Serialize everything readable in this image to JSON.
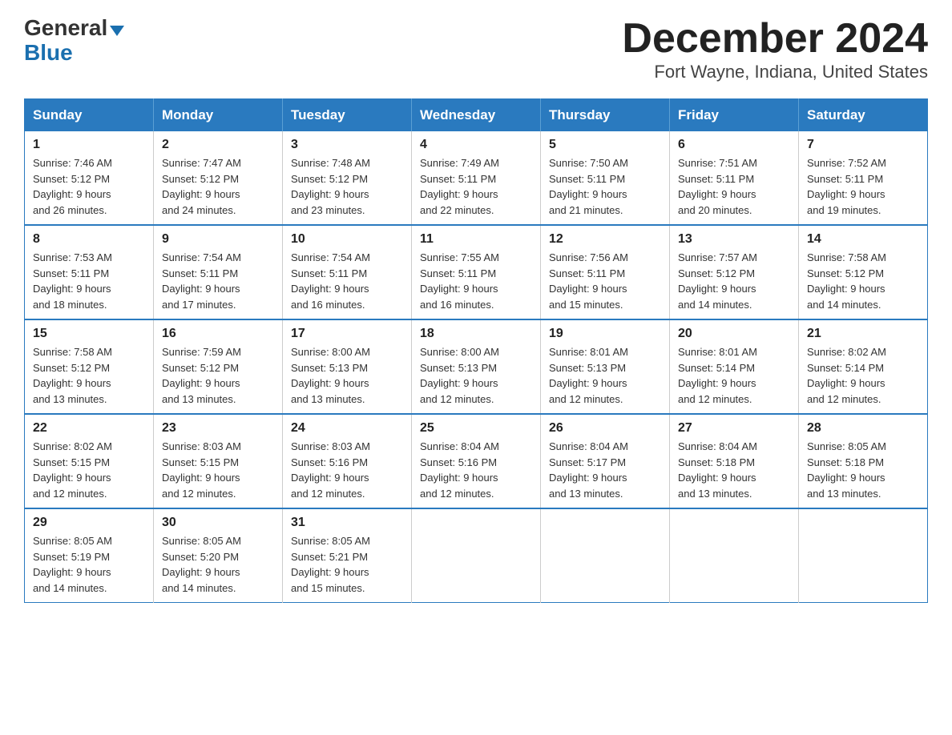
{
  "logo": {
    "general": "General",
    "triangle": "▶",
    "blue": "Blue"
  },
  "title": "December 2024",
  "location": "Fort Wayne, Indiana, United States",
  "days_of_week": [
    "Sunday",
    "Monday",
    "Tuesday",
    "Wednesday",
    "Thursday",
    "Friday",
    "Saturday"
  ],
  "weeks": [
    [
      {
        "day": "1",
        "sunrise": "7:46 AM",
        "sunset": "5:12 PM",
        "daylight": "9 hours and 26 minutes."
      },
      {
        "day": "2",
        "sunrise": "7:47 AM",
        "sunset": "5:12 PM",
        "daylight": "9 hours and 24 minutes."
      },
      {
        "day": "3",
        "sunrise": "7:48 AM",
        "sunset": "5:12 PM",
        "daylight": "9 hours and 23 minutes."
      },
      {
        "day": "4",
        "sunrise": "7:49 AM",
        "sunset": "5:11 PM",
        "daylight": "9 hours and 22 minutes."
      },
      {
        "day": "5",
        "sunrise": "7:50 AM",
        "sunset": "5:11 PM",
        "daylight": "9 hours and 21 minutes."
      },
      {
        "day": "6",
        "sunrise": "7:51 AM",
        "sunset": "5:11 PM",
        "daylight": "9 hours and 20 minutes."
      },
      {
        "day": "7",
        "sunrise": "7:52 AM",
        "sunset": "5:11 PM",
        "daylight": "9 hours and 19 minutes."
      }
    ],
    [
      {
        "day": "8",
        "sunrise": "7:53 AM",
        "sunset": "5:11 PM",
        "daylight": "9 hours and 18 minutes."
      },
      {
        "day": "9",
        "sunrise": "7:54 AM",
        "sunset": "5:11 PM",
        "daylight": "9 hours and 17 minutes."
      },
      {
        "day": "10",
        "sunrise": "7:54 AM",
        "sunset": "5:11 PM",
        "daylight": "9 hours and 16 minutes."
      },
      {
        "day": "11",
        "sunrise": "7:55 AM",
        "sunset": "5:11 PM",
        "daylight": "9 hours and 16 minutes."
      },
      {
        "day": "12",
        "sunrise": "7:56 AM",
        "sunset": "5:11 PM",
        "daylight": "9 hours and 15 minutes."
      },
      {
        "day": "13",
        "sunrise": "7:57 AM",
        "sunset": "5:12 PM",
        "daylight": "9 hours and 14 minutes."
      },
      {
        "day": "14",
        "sunrise": "7:58 AM",
        "sunset": "5:12 PM",
        "daylight": "9 hours and 14 minutes."
      }
    ],
    [
      {
        "day": "15",
        "sunrise": "7:58 AM",
        "sunset": "5:12 PM",
        "daylight": "9 hours and 13 minutes."
      },
      {
        "day": "16",
        "sunrise": "7:59 AM",
        "sunset": "5:12 PM",
        "daylight": "9 hours and 13 minutes."
      },
      {
        "day": "17",
        "sunrise": "8:00 AM",
        "sunset": "5:13 PM",
        "daylight": "9 hours and 13 minutes."
      },
      {
        "day": "18",
        "sunrise": "8:00 AM",
        "sunset": "5:13 PM",
        "daylight": "9 hours and 12 minutes."
      },
      {
        "day": "19",
        "sunrise": "8:01 AM",
        "sunset": "5:13 PM",
        "daylight": "9 hours and 12 minutes."
      },
      {
        "day": "20",
        "sunrise": "8:01 AM",
        "sunset": "5:14 PM",
        "daylight": "9 hours and 12 minutes."
      },
      {
        "day": "21",
        "sunrise": "8:02 AM",
        "sunset": "5:14 PM",
        "daylight": "9 hours and 12 minutes."
      }
    ],
    [
      {
        "day": "22",
        "sunrise": "8:02 AM",
        "sunset": "5:15 PM",
        "daylight": "9 hours and 12 minutes."
      },
      {
        "day": "23",
        "sunrise": "8:03 AM",
        "sunset": "5:15 PM",
        "daylight": "9 hours and 12 minutes."
      },
      {
        "day": "24",
        "sunrise": "8:03 AM",
        "sunset": "5:16 PM",
        "daylight": "9 hours and 12 minutes."
      },
      {
        "day": "25",
        "sunrise": "8:04 AM",
        "sunset": "5:16 PM",
        "daylight": "9 hours and 12 minutes."
      },
      {
        "day": "26",
        "sunrise": "8:04 AM",
        "sunset": "5:17 PM",
        "daylight": "9 hours and 13 minutes."
      },
      {
        "day": "27",
        "sunrise": "8:04 AM",
        "sunset": "5:18 PM",
        "daylight": "9 hours and 13 minutes."
      },
      {
        "day": "28",
        "sunrise": "8:05 AM",
        "sunset": "5:18 PM",
        "daylight": "9 hours and 13 minutes."
      }
    ],
    [
      {
        "day": "29",
        "sunrise": "8:05 AM",
        "sunset": "5:19 PM",
        "daylight": "9 hours and 14 minutes."
      },
      {
        "day": "30",
        "sunrise": "8:05 AM",
        "sunset": "5:20 PM",
        "daylight": "9 hours and 14 minutes."
      },
      {
        "day": "31",
        "sunrise": "8:05 AM",
        "sunset": "5:21 PM",
        "daylight": "9 hours and 15 minutes."
      },
      null,
      null,
      null,
      null
    ]
  ],
  "labels": {
    "sunrise": "Sunrise:",
    "sunset": "Sunset:",
    "daylight": "Daylight:"
  }
}
